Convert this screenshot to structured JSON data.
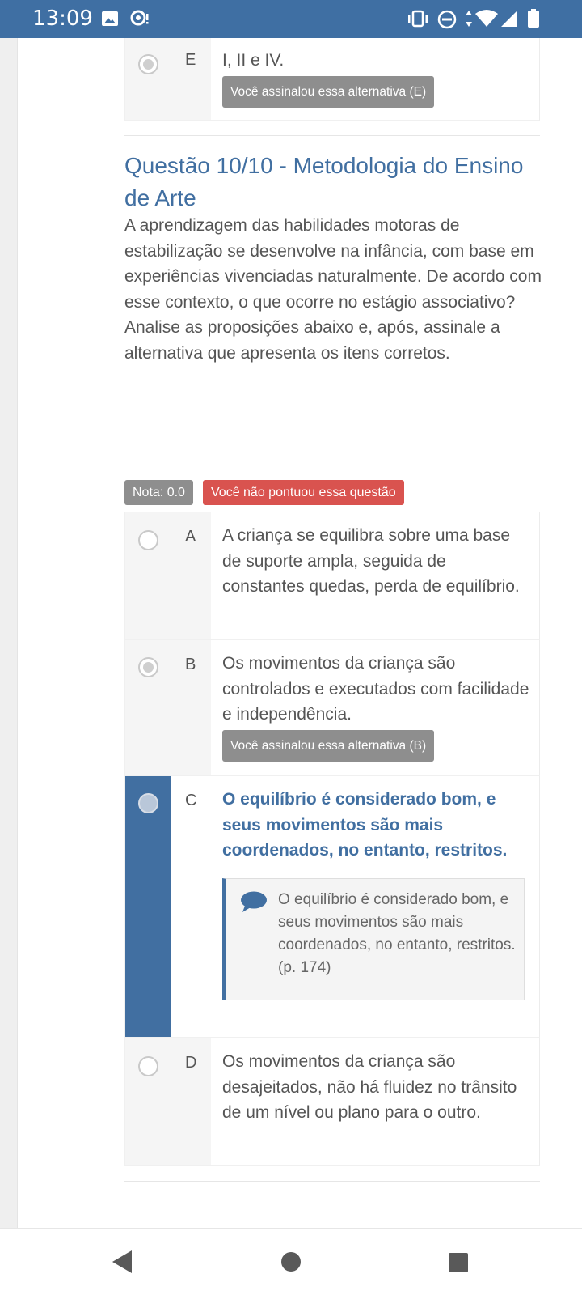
{
  "status_bar": {
    "time": "13:09",
    "icons": [
      "image-icon",
      "chat-bubble-icon",
      "vibrate-icon",
      "do-not-disturb-icon",
      "data-arrows-icon",
      "wifi-icon",
      "signal-icon",
      "battery-icon"
    ]
  },
  "previous_question": {
    "option_e": {
      "letter": "E",
      "text": "I, II e IV.",
      "tag": "Você assinalou essa alternativa (E)"
    }
  },
  "question": {
    "title": "Questão 10/10 - Metodologia do Ensino de Arte",
    "body": "A aprendizagem das habilidades motoras de estabilização se desenvolve na infância, com base em experiências vivenciadas naturalmente. De acordo com esse contexto, o que ocorre no estágio associativo? Analise as proposições abaixo e, após, assinale a alternativa que apresenta os itens corretos.",
    "grade_label": "Nota: 0.0",
    "result_label": "Você não pontuou essa questão",
    "options": [
      {
        "letter": "A",
        "text": "A criança se equilibra sobre uma base de suporte ampla, seguida de constantes quedas, perda de equilíbrio."
      },
      {
        "letter": "B",
        "text": "Os movimentos da criança são controlados e executados com facilidade e independência.",
        "tag": "Você assinalou essa alternativa (B)"
      },
      {
        "letter": "C",
        "text": "O equilíbrio é considerado bom, e seus movimentos são mais coordenados, no entanto, restritos.",
        "feedback": "O equilíbrio é considerado bom, e seus movimentos são mais coordenados, no entanto, restritos. (p. 174)"
      },
      {
        "letter": "D",
        "text": "Os movimentos da criança são desajeitados, não há fluidez no trânsito de um nível ou plano para o outro."
      }
    ]
  },
  "colors": {
    "status_bar": "#3f6fa3",
    "accent": "#416fa1",
    "gray_tag": "#8e8e8e",
    "error_badge": "#d9534f"
  },
  "nav_bar": {
    "icons": [
      "back-triangle-icon",
      "home-circle-icon",
      "recents-square-icon"
    ]
  }
}
